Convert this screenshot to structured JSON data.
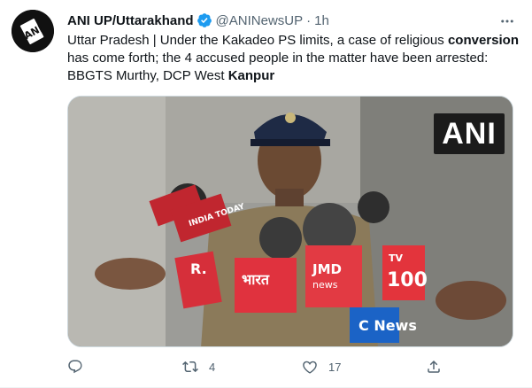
{
  "tweet": {
    "author_name": "ANI UP/Uttarakhand",
    "handle": "@ANINewsUP",
    "separator": "·",
    "time": "1h",
    "text_parts": [
      "Uttar Pradesh | Under the Kakadeo PS limits, a case of religious ",
      "conversion",
      " has come forth; the 4 accused people in the matter have been arrested: BBGTS Murthy, DCP West ",
      "Kanpur"
    ],
    "media": {
      "watermark": "ANI",
      "mic_labels": [
        "INDIA TODAY",
        "R.",
        "भारत",
        "JMD news",
        "TV 100",
        "C News"
      ]
    },
    "actions": {
      "reply_count": "",
      "retweet_count": "4",
      "like_count": "17"
    }
  },
  "colors": {
    "verified": "#1d9bf0",
    "secondary_text": "#536471",
    "border": "#cfd9de"
  }
}
